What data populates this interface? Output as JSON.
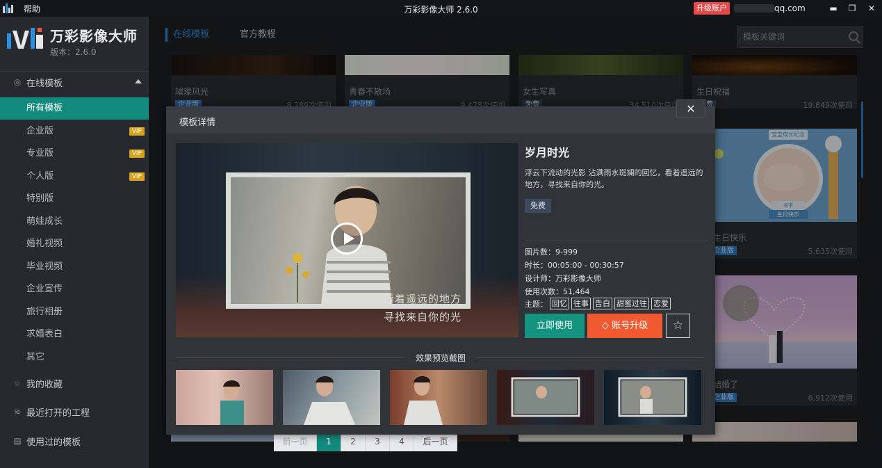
{
  "titlebar": {
    "help": "帮助",
    "title": "万彩影像大师 2.6.0",
    "upgrade_badge": "升级账户",
    "account_email": "qq.com"
  },
  "sidebar": {
    "brand_name": "万彩影像大师",
    "version": "版本：2.6.0",
    "section_online": "在线模板",
    "items": [
      {
        "label": "所有模板",
        "vip": ""
      },
      {
        "label": "企业版",
        "vip": "VIP"
      },
      {
        "label": "专业版",
        "vip": "VIP"
      },
      {
        "label": "个人版",
        "vip": "VIP"
      },
      {
        "label": "特别版",
        "vip": ""
      },
      {
        "label": "萌娃成长",
        "vip": ""
      },
      {
        "label": "婚礼视频",
        "vip": ""
      },
      {
        "label": "毕业视频",
        "vip": ""
      },
      {
        "label": "企业宣传",
        "vip": ""
      },
      {
        "label": "旅行相册",
        "vip": ""
      },
      {
        "label": "求婚表白",
        "vip": ""
      },
      {
        "label": "其它",
        "vip": ""
      }
    ],
    "favorites": "我的收藏",
    "recent_projects": "最近打开的工程",
    "used_templates": "使用过的模板"
  },
  "main": {
    "tabs": [
      "在线模板",
      "官方教程"
    ],
    "search_placeholder": "模板关键词",
    "cards": [
      {
        "title": "璀璨风光",
        "tag": "企业版",
        "usage": "8,289次使用"
      },
      {
        "title": "青春不散场",
        "tag": "企业版",
        "usage": "9,478次使用"
      },
      {
        "title": "女生写真",
        "tag": "免费",
        "usage": "34,510次使用"
      },
      {
        "title": "生日祝福",
        "tag": "免费",
        "usage": "19,849次使用"
      },
      {
        "title": "生日快乐",
        "tag": "企业版",
        "usage": "5,635次使用"
      },
      {
        "title": "结婚了",
        "tag": "企业版",
        "usage": "6,912次使用"
      }
    ],
    "baby_card_labels": [
      "宝宝成长纪念",
      "名字",
      "生日快乐"
    ],
    "pager": [
      "前一页",
      "1",
      "2",
      "3",
      "4",
      "后一页"
    ]
  },
  "modal": {
    "header": "模板详情",
    "close": "✕",
    "name": "岁月时光",
    "description": "浮云下流动的光影 沾满雨水斑斓的回忆，看着遥远的地方，寻找来自你的光。",
    "badge": "免费",
    "meta": {
      "images": "图片数：9-999",
      "duration": "时长：00:05:00 - 00:30:57",
      "designer": "设计师：万彩影像大师",
      "usage": "使用次数：51,464"
    },
    "topics_label": "主题：",
    "topics": [
      "回忆",
      "往事",
      "告白",
      "甜蜜过往",
      "恋爱"
    ],
    "video_caption_1": "看着遥远的地方",
    "video_caption_2": "寻找来自你的光",
    "btn_use": "立即使用",
    "btn_upgrade": "账号升级",
    "preview_heading": "效果预览截图"
  },
  "colors": {
    "accent_teal": "#138a7e",
    "accent_blue": "#2f8fdc",
    "upgrade_orange": "#f15a30",
    "vip_gold": "#d8a21c"
  }
}
